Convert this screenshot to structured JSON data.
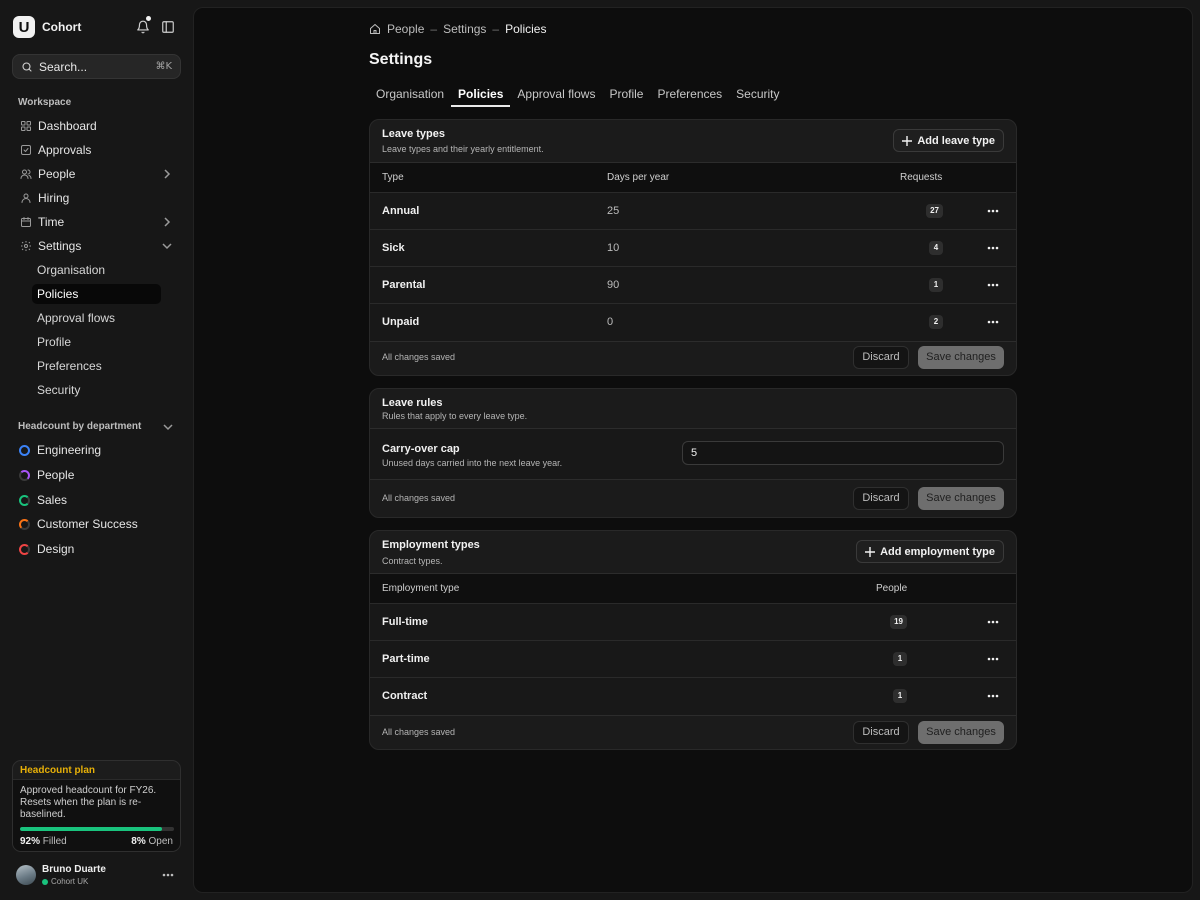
{
  "app": {
    "name": "Cohort",
    "logo_letter": "U"
  },
  "search": {
    "label": "Search...",
    "shortcut": "⌘K"
  },
  "sidebar": {
    "workspace_label": "Workspace",
    "items": [
      {
        "label": "Dashboard",
        "icon": "grid-icon"
      },
      {
        "label": "Approvals",
        "icon": "check-square-icon"
      },
      {
        "label": "People",
        "icon": "users-icon"
      },
      {
        "label": "Hiring",
        "icon": "user-icon"
      },
      {
        "label": "Time",
        "icon": "calendar-icon"
      },
      {
        "label": "Settings",
        "icon": "gear-icon"
      }
    ],
    "settings_children": [
      "Organisation",
      "Policies",
      "Approval flows",
      "Profile",
      "Preferences",
      "Security"
    ],
    "active_child": "Policies",
    "dept_label": "Headcount by department",
    "departments": [
      {
        "label": "Engineering",
        "color": "#3b82f6"
      },
      {
        "label": "People",
        "color": "#a855f7"
      },
      {
        "label": "Sales",
        "color": "#19c37d"
      },
      {
        "label": "Customer Success",
        "color": "#f97316"
      },
      {
        "label": "Design",
        "color": "#ef4444"
      }
    ]
  },
  "plan": {
    "title": "Headcount plan",
    "text": "Approved headcount for FY26. Resets when the plan is re-baselined.",
    "filled_pct": "92%",
    "filled_label": "Filled",
    "open_pct": "8%",
    "open_label": "Open",
    "filled_fraction": 0.92
  },
  "user": {
    "name": "Bruno Duarte",
    "org": "Cohort UK"
  },
  "breadcrumb": [
    "People",
    "Settings",
    "Policies"
  ],
  "page_title": "Settings",
  "tabs": [
    "Organisation",
    "Policies",
    "Approval flows",
    "Profile",
    "Preferences",
    "Security"
  ],
  "active_tab": "Policies",
  "leave_types": {
    "title": "Leave types",
    "subtitle": "Leave types and their yearly entitlement.",
    "add_label": "Add leave type",
    "columns": [
      "Type",
      "Days per year",
      "Requests"
    ],
    "rows": [
      {
        "type": "Annual",
        "days": "25",
        "requests": "27"
      },
      {
        "type": "Sick",
        "days": "10",
        "requests": "4"
      },
      {
        "type": "Parental",
        "days": "90",
        "requests": "1"
      },
      {
        "type": "Unpaid",
        "days": "0",
        "requests": "2"
      }
    ],
    "status": "All changes saved",
    "discard": "Discard",
    "save": "Save changes"
  },
  "leave_rules": {
    "title": "Leave rules",
    "subtitle": "Rules that apply to every leave type.",
    "rule_label": "Carry-over cap",
    "rule_sub": "Unused days carried into the next leave year.",
    "rule_value": "5",
    "status": "All changes saved",
    "discard": "Discard",
    "save": "Save changes"
  },
  "employment_types": {
    "title": "Employment types",
    "subtitle": "Contract types.",
    "add_label": "Add employment type",
    "columns": [
      "Employment type",
      "People"
    ],
    "rows": [
      {
        "type": "Full-time",
        "people": "19"
      },
      {
        "type": "Part-time",
        "people": "1"
      },
      {
        "type": "Contract",
        "people": "1"
      }
    ],
    "status": "All changes saved",
    "discard": "Discard",
    "save": "Save changes"
  }
}
